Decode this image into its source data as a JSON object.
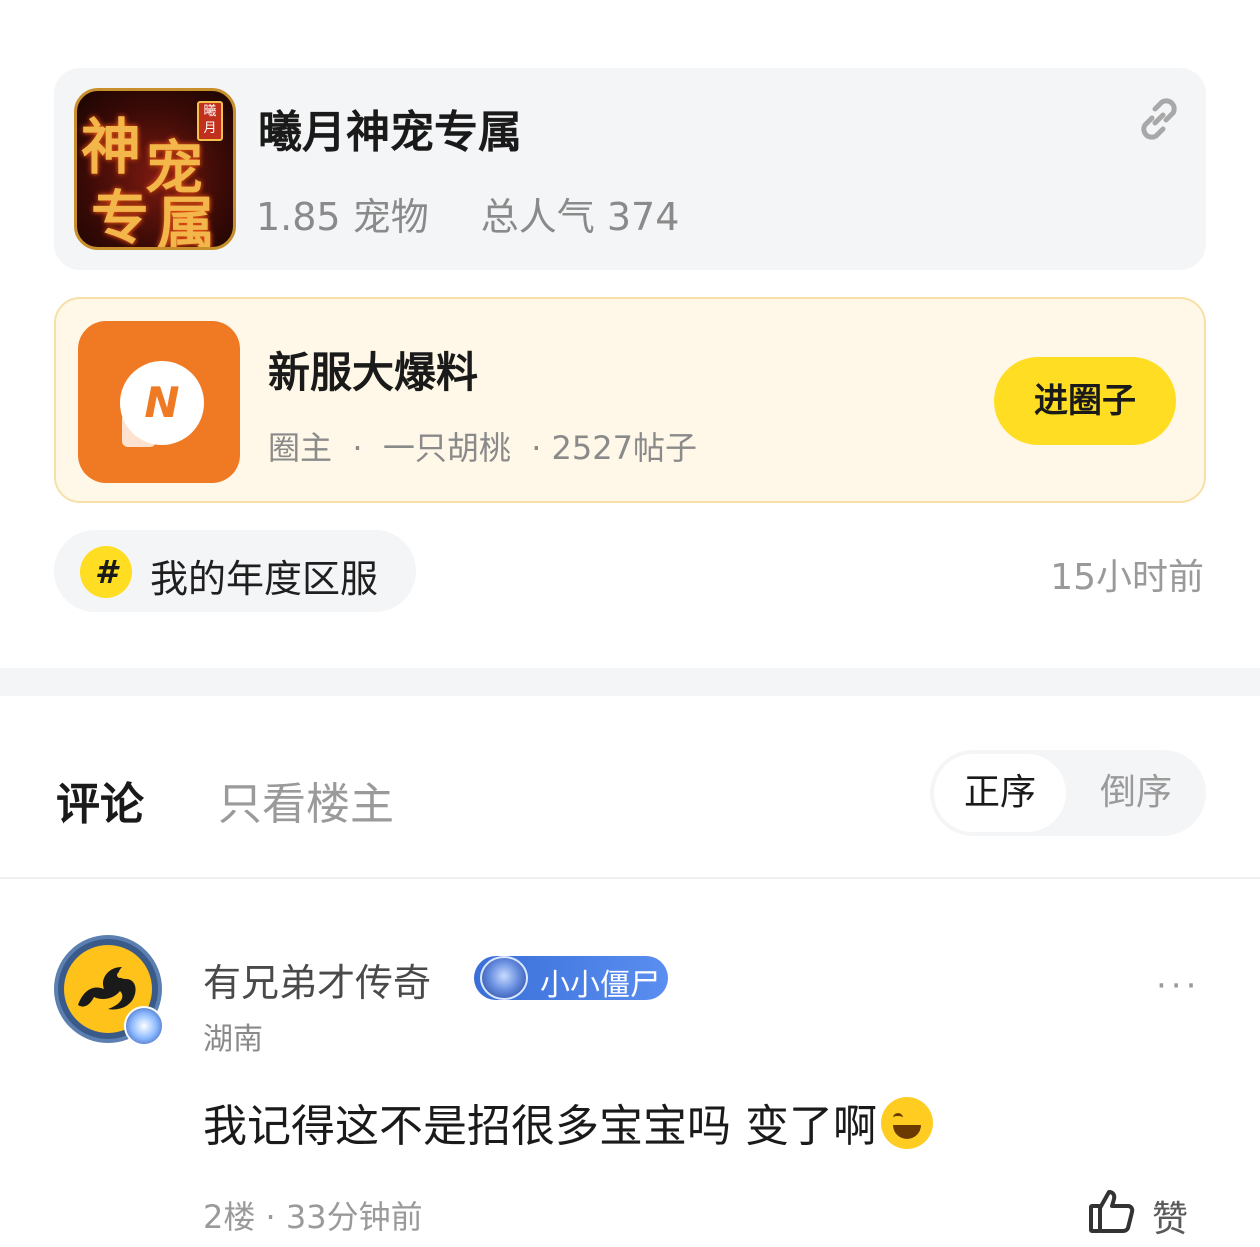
{
  "game": {
    "title": "曦月神宠专属",
    "version": "1.85 宠物",
    "popularity": "总人气 374",
    "logo_chars": [
      "神",
      "宠",
      "专",
      "属"
    ],
    "logo_badge": "曦月",
    "link_icon": "link-icon"
  },
  "circle": {
    "title": "新服大爆料",
    "meta": "圈主  ·  一只胡桃  · 2527帖子",
    "join_label": "进圈子",
    "logo_letter": "N",
    "accent": "#f07a24",
    "button_color": "#ffdd22"
  },
  "topic": {
    "hash": "#",
    "label": "我的年度区服",
    "time": "15小时前"
  },
  "tabs": {
    "comments": "评论",
    "op_only": "只看楼主",
    "sort_asc": "正序",
    "sort_desc": "倒序"
  },
  "comment": {
    "username": "有兄弟才传奇",
    "level": "小小僵尸",
    "location": "湖南",
    "text": "我记得这不是招很多宝宝吗 变了啊",
    "emoji": "laughing-tears-emoji",
    "meta": "2楼 · 33分钟前",
    "like_label": "赞",
    "more": "···"
  }
}
